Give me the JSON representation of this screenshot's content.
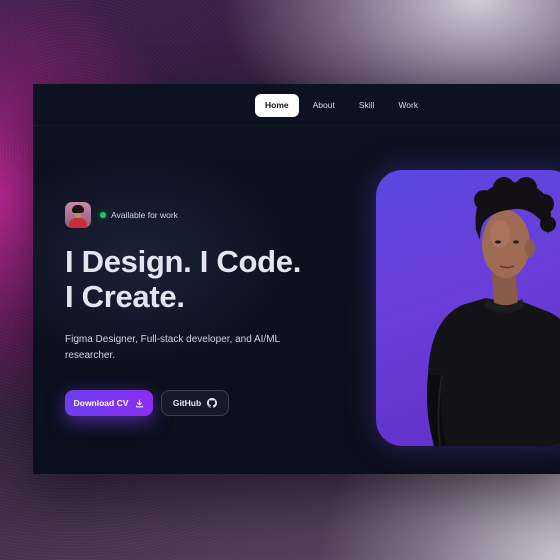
{
  "nav": {
    "items": [
      {
        "label": "Home",
        "active": true
      },
      {
        "label": "About",
        "active": false
      },
      {
        "label": "Skill",
        "active": false
      },
      {
        "label": "Work",
        "active": false
      }
    ]
  },
  "status": {
    "text": "Available for work",
    "dot_color": "#22c55e"
  },
  "hero": {
    "headline_line1": "I Design. I Code.",
    "headline_line2": "I Create.",
    "subtitle": "Figma Designer, Full-stack developer, and AI/ML researcher."
  },
  "buttons": {
    "download_label": "Download CV",
    "download_icon": "download-icon",
    "github_label": "GitHub",
    "github_icon": "github-icon"
  },
  "colors": {
    "accent": "#7c3aed",
    "background": "#0b0f1b",
    "card": "#6a3ed8"
  }
}
